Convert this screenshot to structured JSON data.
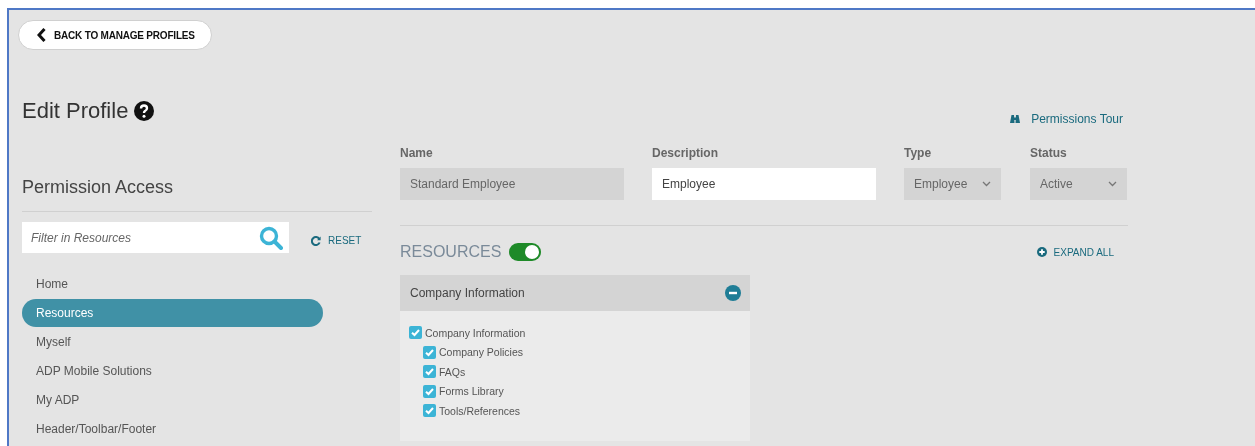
{
  "back_button": {
    "label": "BACK TO MANAGE PROFILES"
  },
  "title": "Edit Profile",
  "tour_link": "Permissions Tour",
  "fields": [
    {
      "label": "Name",
      "kind": "text",
      "value": "Standard Employee",
      "disabled": true
    },
    {
      "label": "Description",
      "kind": "text",
      "value": "Employee",
      "disabled": false
    },
    {
      "label": "Type",
      "kind": "select",
      "value": "Employee",
      "disabled": true
    },
    {
      "label": "Status",
      "kind": "select",
      "value": "Active",
      "disabled": true
    }
  ],
  "sidebar": {
    "heading": "Permission Access",
    "filter": {
      "placeholder": "Filter in Resources"
    },
    "reset": "RESET",
    "items": [
      {
        "label": "Home",
        "selected": false
      },
      {
        "label": "Resources",
        "selected": true
      },
      {
        "label": "Myself",
        "selected": false
      },
      {
        "label": "ADP Mobile Solutions",
        "selected": false
      },
      {
        "label": "My ADP",
        "selected": false
      },
      {
        "label": "Header/Toolbar/Footer",
        "selected": false
      }
    ]
  },
  "resources": {
    "heading": "RESOURCES",
    "on": true,
    "expand_all": "EXPAND ALL",
    "panels": [
      {
        "title": "Company Information",
        "expanded": true,
        "tree": [
          {
            "label": "Company Information",
            "checked": true,
            "children": [
              {
                "label": "Company Policies",
                "checked": true
              },
              {
                "label": "FAQs",
                "checked": true
              },
              {
                "label": "Forms Library",
                "checked": true
              },
              {
                "label": "Tools/References",
                "checked": true
              }
            ]
          }
        ]
      }
    ]
  }
}
